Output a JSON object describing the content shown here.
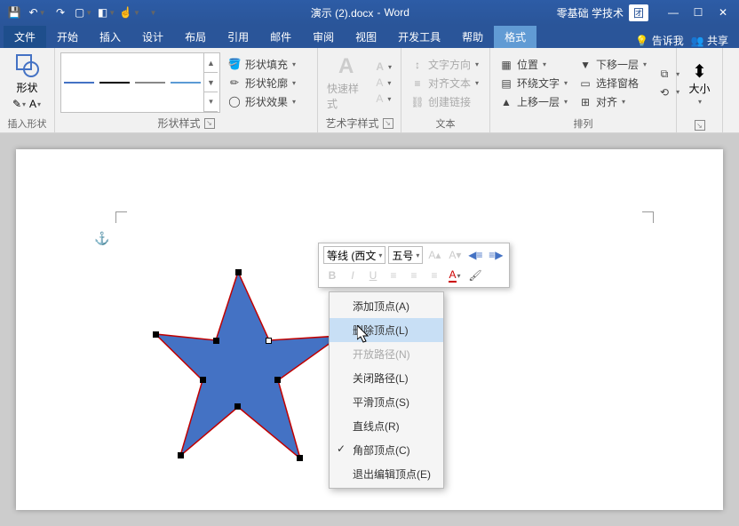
{
  "title": {
    "doc": "演示 (2).docx",
    "app": "Word",
    "brand": "零基础 学技术",
    "user": "团"
  },
  "tabs": {
    "file": "文件",
    "items": [
      "开始",
      "插入",
      "设计",
      "布局",
      "引用",
      "邮件",
      "审阅",
      "视图",
      "开发工具",
      "帮助",
      "格式"
    ],
    "active": "格式",
    "tellme": "告诉我",
    "share": "共享"
  },
  "ribbon": {
    "insertShape": {
      "label": "形状",
      "group": "插入形状"
    },
    "shapeStyles": {
      "group": "形状样式",
      "fill": "形状填充",
      "outline": "形状轮廓",
      "effects": "形状效果"
    },
    "wordArt": {
      "group": "艺术字样式",
      "quick": "快速样式"
    },
    "text": {
      "group": "文本",
      "direction": "文字方向",
      "align": "对齐文本",
      "link": "创建链接"
    },
    "arrange": {
      "group": "排列",
      "position": "位置",
      "wrap": "环绕文字",
      "forward": "上移一层",
      "backward": "下移一层",
      "selection": "选择窗格",
      "alignObj": "对齐"
    },
    "size": {
      "group": "大小",
      "label": "大小"
    }
  },
  "miniToolbar": {
    "font": "等线 (西文",
    "size": "五号"
  },
  "contextMenu": {
    "items": [
      {
        "label": "添加顶点(A)",
        "state": "normal"
      },
      {
        "label": "删除顶点(L)",
        "state": "highlight"
      },
      {
        "label": "开放路径(N)",
        "state": "disabled"
      },
      {
        "label": "关闭路径(L)",
        "state": "normal"
      },
      {
        "label": "平滑顶点(S)",
        "state": "normal"
      },
      {
        "label": "直线点(R)",
        "state": "normal"
      },
      {
        "label": "角部顶点(C)",
        "state": "checked"
      },
      {
        "label": "退出编辑顶点(E)",
        "state": "normal"
      }
    ]
  },
  "colors": {
    "accent": "#4472C4",
    "titlebar": "#2a5599"
  }
}
